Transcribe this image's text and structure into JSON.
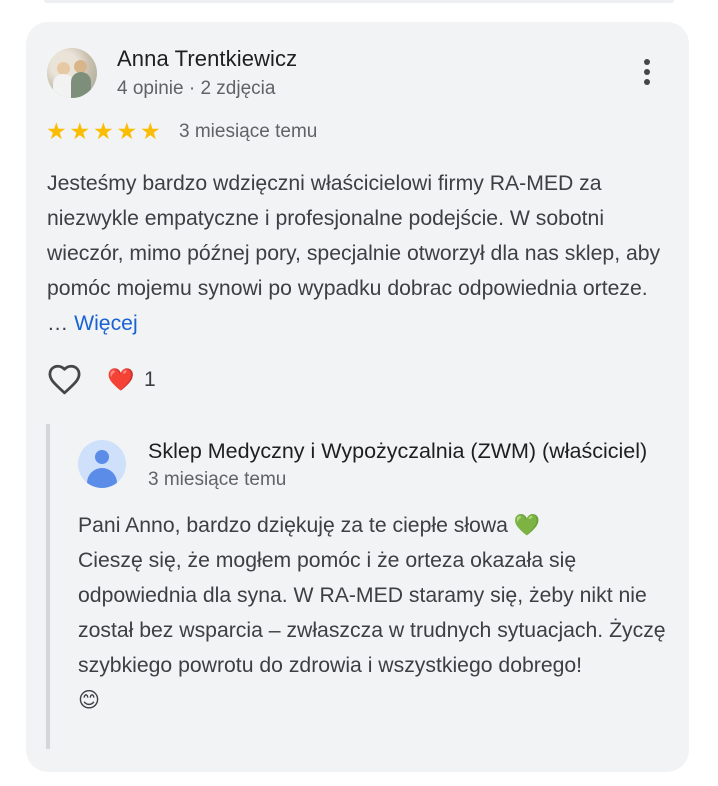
{
  "review": {
    "author_name": "Anna Trentkiewicz",
    "author_meta": "4 opinie · 2 zdjęcia",
    "rating": 5,
    "stars": [
      "★",
      "★",
      "★",
      "★",
      "★"
    ],
    "time": "3 miesiące temu",
    "text": "Jesteśmy bardzo wdzięczni właścicielowi firmy RA-MED za niezwykle empatyczne i profesjonalne podejście. W sobotni wieczór, mimo późnej pory, specjalnie otworzył dla nas sklep, aby pomóc mojemu synowi po wypadku dobrac odpowiednia orteze. …",
    "more_label": "Więcej",
    "more_icon": "more-vert-icon"
  },
  "reactions": {
    "like_icon": "heart-outline-icon",
    "emoji": "❤️",
    "count": "1"
  },
  "reply": {
    "owner_name": "Sklep Medyczny i Wypożyczalnia (ZWM) (właściciel)",
    "time": "3 miesiące temu",
    "text": "Pani Anno, bardzo dziękuję za te ciepłe słowa 💚\nCieszę się, że mogłem pomóc i że orteza okazała się odpowiednia dla syna. W RA-MED staramy się, żeby nikt nie został bez wsparcia – zwłaszcza w trudnych sytuacjach. Życzę szybkiego powrotu do zdrowia i wszystkiego dobrego!\n😊"
  },
  "colors": {
    "card_bg": "#f1f3f4",
    "star": "#fbbc04",
    "link": "#1a62d4",
    "secondary_text": "#5f6368",
    "reply_bar": "#d3d6db"
  }
}
